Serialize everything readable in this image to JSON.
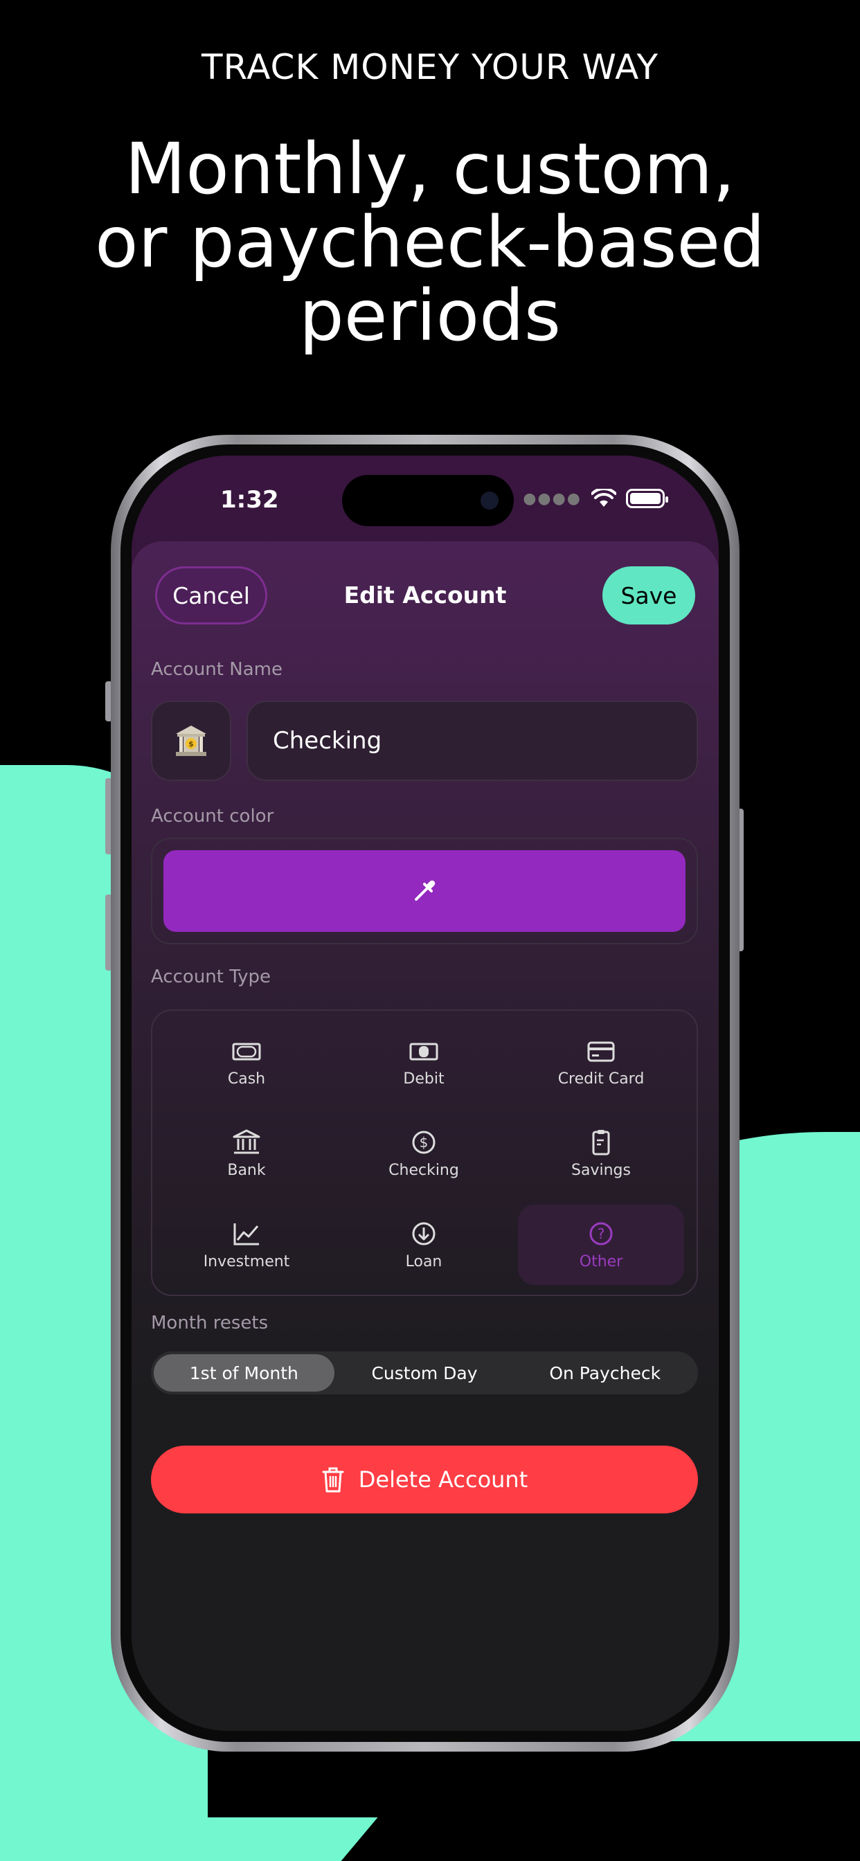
{
  "promo": {
    "eyebrow": "TRACK MONEY YOUR WAY",
    "headline": "Monthly, custom, or paycheck-based periods"
  },
  "status_bar": {
    "time": "1:32"
  },
  "nav": {
    "cancel_label": "Cancel",
    "title": "Edit Account",
    "save_label": "Save"
  },
  "account_name": {
    "label": "Account Name",
    "value": "Checking",
    "icon": "bank-building-icon"
  },
  "account_color": {
    "label": "Account color",
    "value": "#9329bf",
    "icon": "eyedropper-icon"
  },
  "account_type": {
    "label": "Account Type",
    "options": [
      {
        "label": "Cash",
        "icon": "cash-icon"
      },
      {
        "label": "Debit",
        "icon": "debit-icon"
      },
      {
        "label": "Credit Card",
        "icon": "credit-card-icon"
      },
      {
        "label": "Bank",
        "icon": "bank-icon"
      },
      {
        "label": "Checking",
        "icon": "dollar-circle-icon"
      },
      {
        "label": "Savings",
        "icon": "clipboard-icon"
      },
      {
        "label": "Investment",
        "icon": "chart-up-icon"
      },
      {
        "label": "Loan",
        "icon": "arrow-down-circle-icon"
      },
      {
        "label": "Other",
        "icon": "question-circle-icon"
      }
    ],
    "selected": "Other"
  },
  "month_resets": {
    "label": "Month resets",
    "options": [
      "1st of Month",
      "Custom Day",
      "On Paycheck"
    ],
    "selected": "1st of Month"
  },
  "delete_label": "Delete Account",
  "colors": {
    "accent_mint": "#72f7cf",
    "save_button": "#60e6c2",
    "delete": "#ff3d44",
    "selected_type": "#9a3cc0"
  }
}
